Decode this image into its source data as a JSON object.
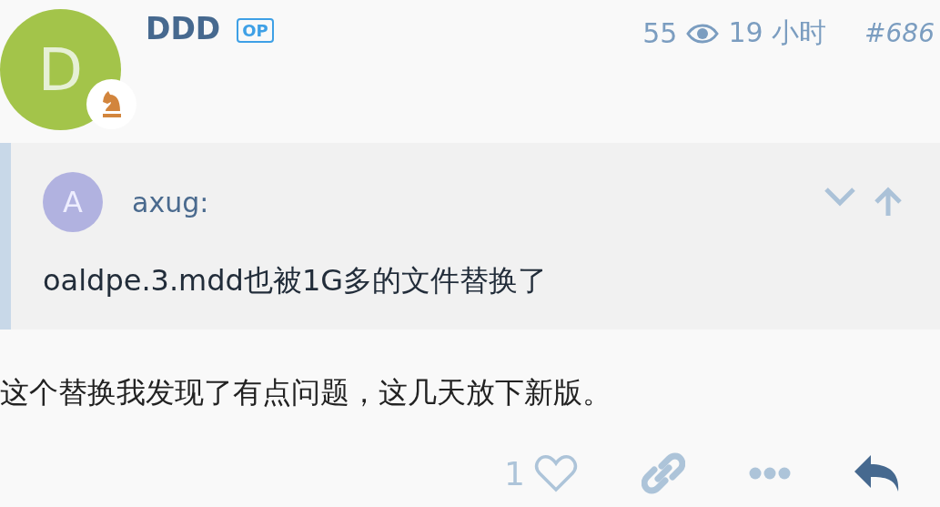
{
  "post": {
    "author": {
      "name": "DDD",
      "avatar_letter": "D"
    },
    "op_badge": "OP",
    "views": "55",
    "time": "19 小时",
    "post_number": "#686"
  },
  "quote": {
    "author": {
      "name": "axug:",
      "avatar_letter": "A"
    },
    "text": "oaldpe.3.mdd也被1G多的文件替换了"
  },
  "body": "这个替换我发现了有点问题，这几天放下新版。",
  "actions": {
    "like_count": "1"
  }
}
